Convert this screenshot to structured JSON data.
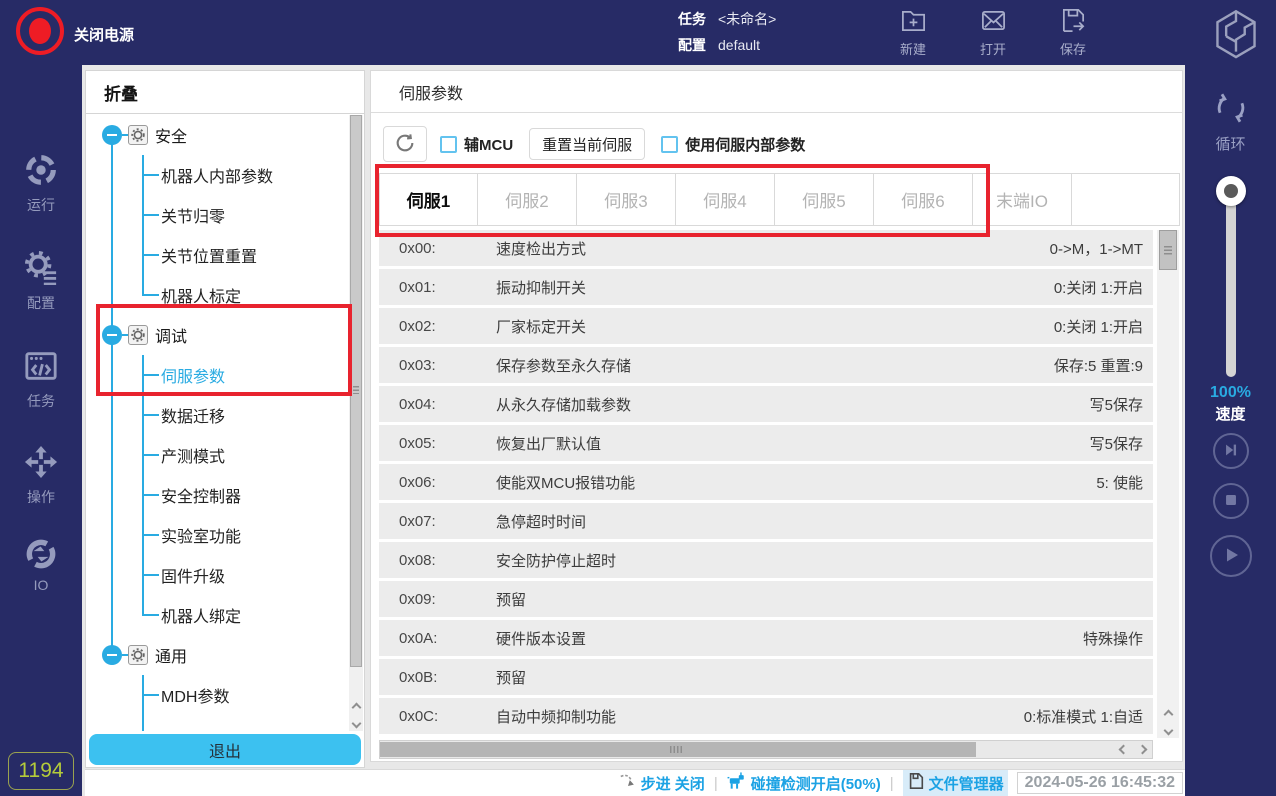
{
  "colors": {
    "navy": "#272b66",
    "accent": "#29abe2",
    "highlight_red": "#e8232e",
    "exit_button": "#3cc1f0",
    "counter_text": "#b5cc3a",
    "status_blue": "#1ba2e4"
  },
  "topbar": {
    "power_label": "关闭电源",
    "task_label": "任务",
    "task_value": "<未命名>",
    "config_label": "配置",
    "config_value": "default",
    "actions": {
      "new": "新建",
      "open": "打开",
      "save": "保存"
    }
  },
  "left_nav": {
    "items": [
      "运行",
      "配置",
      "任务",
      "操作",
      "IO"
    ]
  },
  "counter": "1194",
  "tree": {
    "header": "折叠",
    "selected": "伺服参数",
    "groups": [
      {
        "label": "安全",
        "children": [
          "机器人内部参数",
          "关节归零",
          "关节位置重置",
          "机器人标定"
        ]
      },
      {
        "label": "调试",
        "children": [
          "伺服参数",
          "数据迁移",
          "产测模式",
          "安全控制器",
          "实验室功能",
          "固件升级",
          "机器人绑定"
        ]
      },
      {
        "label": "通用",
        "children": [
          "MDH参数"
        ]
      }
    ],
    "exit_label": "退出"
  },
  "main": {
    "title": "伺服参数",
    "toolbar": {
      "aux_mcu_label": "辅MCU",
      "reset_label": "重置当前伺服",
      "use_internal_label": "使用伺服内部参数"
    },
    "tabs": [
      "伺服1",
      "伺服2",
      "伺服3",
      "伺服4",
      "伺服5",
      "伺服6",
      "末端IO"
    ],
    "active_tab": "伺服1",
    "table": {
      "rows": [
        {
          "addr": "0x00:",
          "name": "速度检出方式",
          "value": "0->M，1->MT"
        },
        {
          "addr": "0x01:",
          "name": "振动抑制开关",
          "value": "0:关闭 1:开启"
        },
        {
          "addr": "0x02:",
          "name": "厂家标定开关",
          "value": "0:关闭 1:开启"
        },
        {
          "addr": "0x03:",
          "name": "保存参数至永久存储",
          "value": "保存:5 重置:9"
        },
        {
          "addr": "0x04:",
          "name": "从永久存储加载参数",
          "value": "写5保存"
        },
        {
          "addr": "0x05:",
          "name": "恢复出厂默认值",
          "value": "写5保存"
        },
        {
          "addr": "0x06:",
          "name": "使能双MCU报错功能",
          "value": "5: 使能"
        },
        {
          "addr": "0x07:",
          "name": "急停超时时间",
          "value": ""
        },
        {
          "addr": "0x08:",
          "name": "安全防护停止超时",
          "value": ""
        },
        {
          "addr": "0x09:",
          "name": "预留",
          "value": ""
        },
        {
          "addr": "0x0A:",
          "name": "硬件版本设置",
          "value": "特殊操作"
        },
        {
          "addr": "0x0B:",
          "name": "预留",
          "value": ""
        },
        {
          "addr": "0x0C:",
          "name": "自动中频抑制功能",
          "value": "0:标准模式 1:自适"
        }
      ]
    }
  },
  "right_panel": {
    "loop_label": "循环",
    "speed_value": "100%",
    "speed_label": "速度"
  },
  "statusbar": {
    "step_label": "步进 关闭",
    "collision_label": "碰撞检测开启(50%)",
    "file_manager_label": "文件管理器",
    "timestamp": "2024-05-26 16:45:32"
  }
}
